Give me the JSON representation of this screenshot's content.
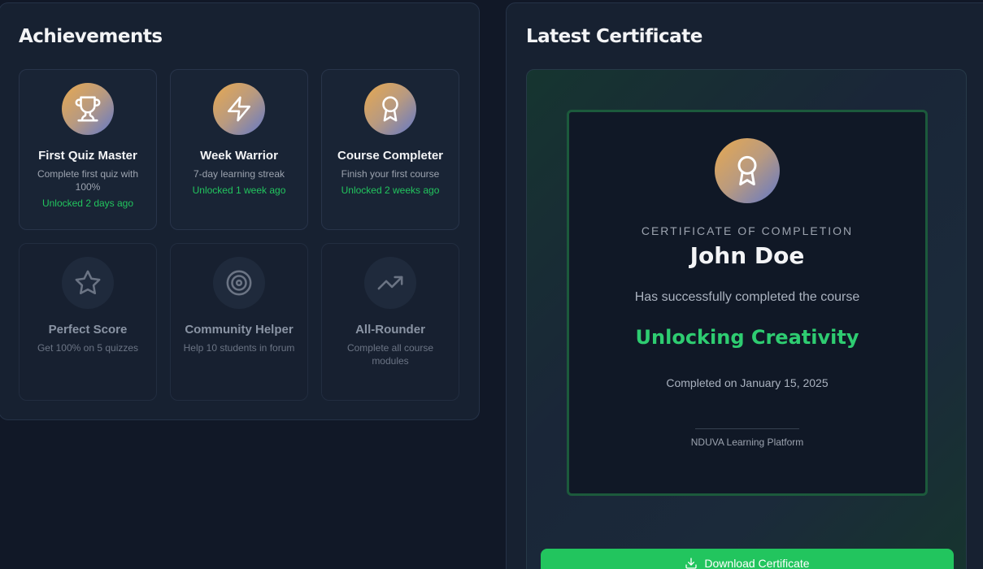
{
  "achievements": {
    "title": "Achievements",
    "cards": [
      {
        "title": "First Quiz Master",
        "desc": "Complete first quiz with 100%",
        "status": "Unlocked 2 days ago",
        "icon": "trophy-icon",
        "unlocked": true
      },
      {
        "title": "Week Warrior",
        "desc": "7-day learning streak",
        "status": "Unlocked 1 week ago",
        "icon": "lightning-icon",
        "unlocked": true
      },
      {
        "title": "Course Completer",
        "desc": "Finish your first course",
        "status": "Unlocked 2 weeks ago",
        "icon": "award-ribbon-icon",
        "unlocked": true
      },
      {
        "title": "Perfect Score",
        "desc": "Get 100% on 5 quizzes",
        "icon": "star-icon",
        "unlocked": false
      },
      {
        "title": "Community Helper",
        "desc": "Help 10 students in forum",
        "icon": "target-icon",
        "unlocked": false
      },
      {
        "title": "All-Rounder",
        "desc": "Complete all course modules",
        "icon": "trending-up-icon",
        "unlocked": false
      }
    ]
  },
  "certificate": {
    "title": "Latest Certificate",
    "heading": "CERTIFICATE OF COMPLETION",
    "recipient": "John Doe",
    "line": "Has successfully completed the course",
    "course": "Unlocking Creativity",
    "date": "Completed on January 15, 2025",
    "platform": "NDUVA Learning Platform",
    "download_label": "Download Certificate"
  },
  "colors": {
    "accent_green": "#22c55e",
    "background": "#111827",
    "panel": "#172131"
  }
}
